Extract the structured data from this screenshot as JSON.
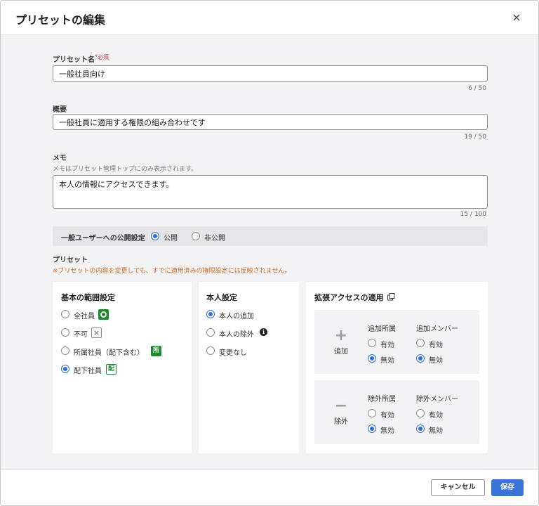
{
  "dialog": {
    "title": "プリセットの編集",
    "close_icon": "×"
  },
  "form": {
    "name": {
      "label": "プリセット名",
      "required_mark": "*",
      "required_text": "必須",
      "value": "一般社員向け",
      "counter": "6 / 50"
    },
    "summary": {
      "label": "概要",
      "value": "一般社員に適用する権限の組み合わせです",
      "counter": "19 / 50"
    },
    "memo": {
      "label": "メモ",
      "hint": "メモはプリセット管理トップにのみ表示されます。",
      "value": "本人の情報にアクセスできます。",
      "counter": "15 / 100"
    },
    "visibility": {
      "label": "一般ユーザーへの公開設定",
      "options": [
        "公開",
        "非公開"
      ],
      "selected": "公開"
    }
  },
  "preset": {
    "title": "プリセット",
    "warning": "※プリセットの内容を変更しても、すでに適用済みの権限設定には反映されません。",
    "scope": {
      "title": "基本の範囲設定",
      "options": [
        {
          "label": "全社員",
          "badge": "○",
          "badge_icon": "circle-icon"
        },
        {
          "label": "不可",
          "badge": "×",
          "badge_icon": "x-icon"
        },
        {
          "label": "所属社員（配下含む）",
          "badge": "所"
        },
        {
          "label": "配下社員",
          "badge": "配"
        }
      ],
      "selected_index": 3
    },
    "self": {
      "title": "本人設定",
      "options": [
        "本人の追加",
        "本人の除外",
        "変更なし"
      ],
      "info_icon": "i",
      "selected_index": 0
    },
    "extended": {
      "title": "拡張アクセスの適用",
      "add": {
        "sign": "+",
        "label": "追加",
        "col1": "追加所属",
        "col2": "追加メンバー",
        "opt_on": "有効",
        "opt_off": "無効"
      },
      "remove": {
        "sign": "−",
        "label": "除外",
        "col1": "除外所属",
        "col2": "除外メンバー",
        "opt_on": "有効",
        "opt_off": "無効"
      }
    }
  },
  "footer": {
    "cancel_label": "キャンセル",
    "save_label": "保存"
  },
  "colors": {
    "accent": "#3a73d8",
    "warning": "#d2691e",
    "badge_green": "#1c8a2e"
  }
}
